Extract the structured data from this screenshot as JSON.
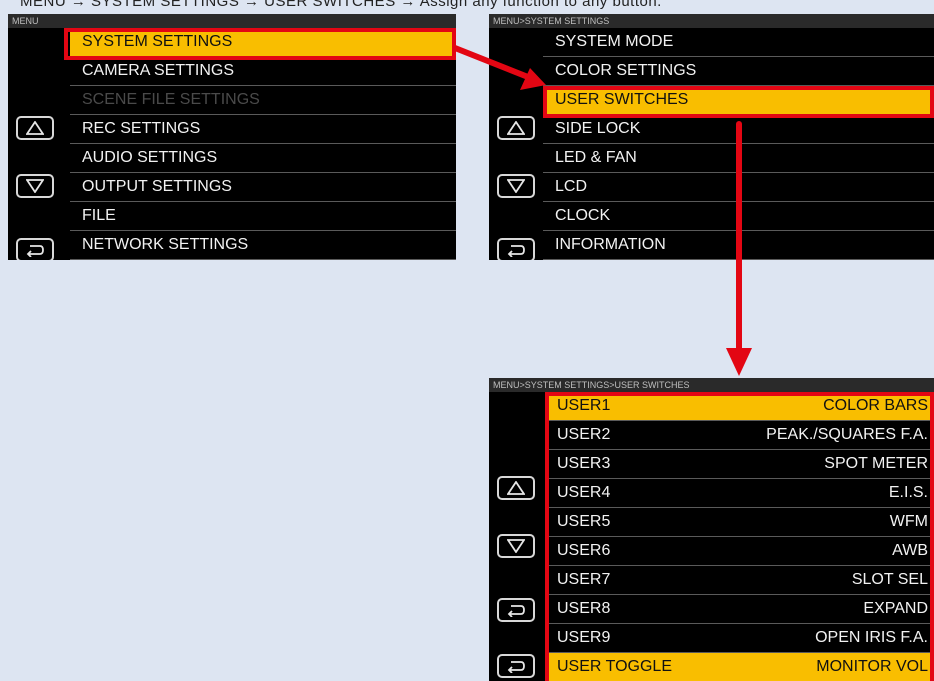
{
  "caption": "MENU → SYSTEM SETTINGS → USER SWITCHES → Assign any function to any button.",
  "colors": {
    "highlight": "#f9be00",
    "callout_red": "#e30613",
    "screen_bg": "#000000"
  },
  "icons": {
    "up": "up-triangle-icon",
    "down": "down-triangle-icon",
    "back": "return-arrow-icon"
  },
  "screen1": {
    "breadcrumb": "MENU",
    "items": [
      "SYSTEM SETTINGS",
      "CAMERA SETTINGS",
      "SCENE FILE SETTINGS",
      "REC SETTINGS",
      "AUDIO SETTINGS",
      "OUTPUT SETTINGS",
      "FILE",
      "NETWORK SETTINGS"
    ],
    "selected": "SYSTEM SETTINGS",
    "disabled": "SCENE FILE SETTINGS"
  },
  "screen2": {
    "breadcrumb": "MENU>SYSTEM SETTINGS",
    "items": [
      "SYSTEM MODE",
      "COLOR SETTINGS",
      "USER SWITCHES",
      "SIDE LOCK",
      "LED & FAN",
      "LCD",
      "CLOCK",
      "INFORMATION"
    ],
    "selected": "USER SWITCHES"
  },
  "screen3": {
    "breadcrumb": "MENU>SYSTEM SETTINGS>USER SWITCHES",
    "rows": [
      {
        "name": "USER1",
        "value": "COLOR BARS"
      },
      {
        "name": "USER2",
        "value": "PEAK./SQUARES F.A."
      },
      {
        "name": "USER3",
        "value": "SPOT METER"
      },
      {
        "name": "USER4",
        "value": "E.I.S."
      },
      {
        "name": "USER5",
        "value": "WFM"
      },
      {
        "name": "USER6",
        "value": "AWB"
      },
      {
        "name": "USER7",
        "value": "SLOT SEL"
      },
      {
        "name": "USER8",
        "value": "EXPAND"
      },
      {
        "name": "USER9",
        "value": "OPEN IRIS F.A."
      },
      {
        "name": "USER TOGGLE",
        "value": "MONITOR VOL"
      }
    ],
    "selected": "USER1"
  }
}
